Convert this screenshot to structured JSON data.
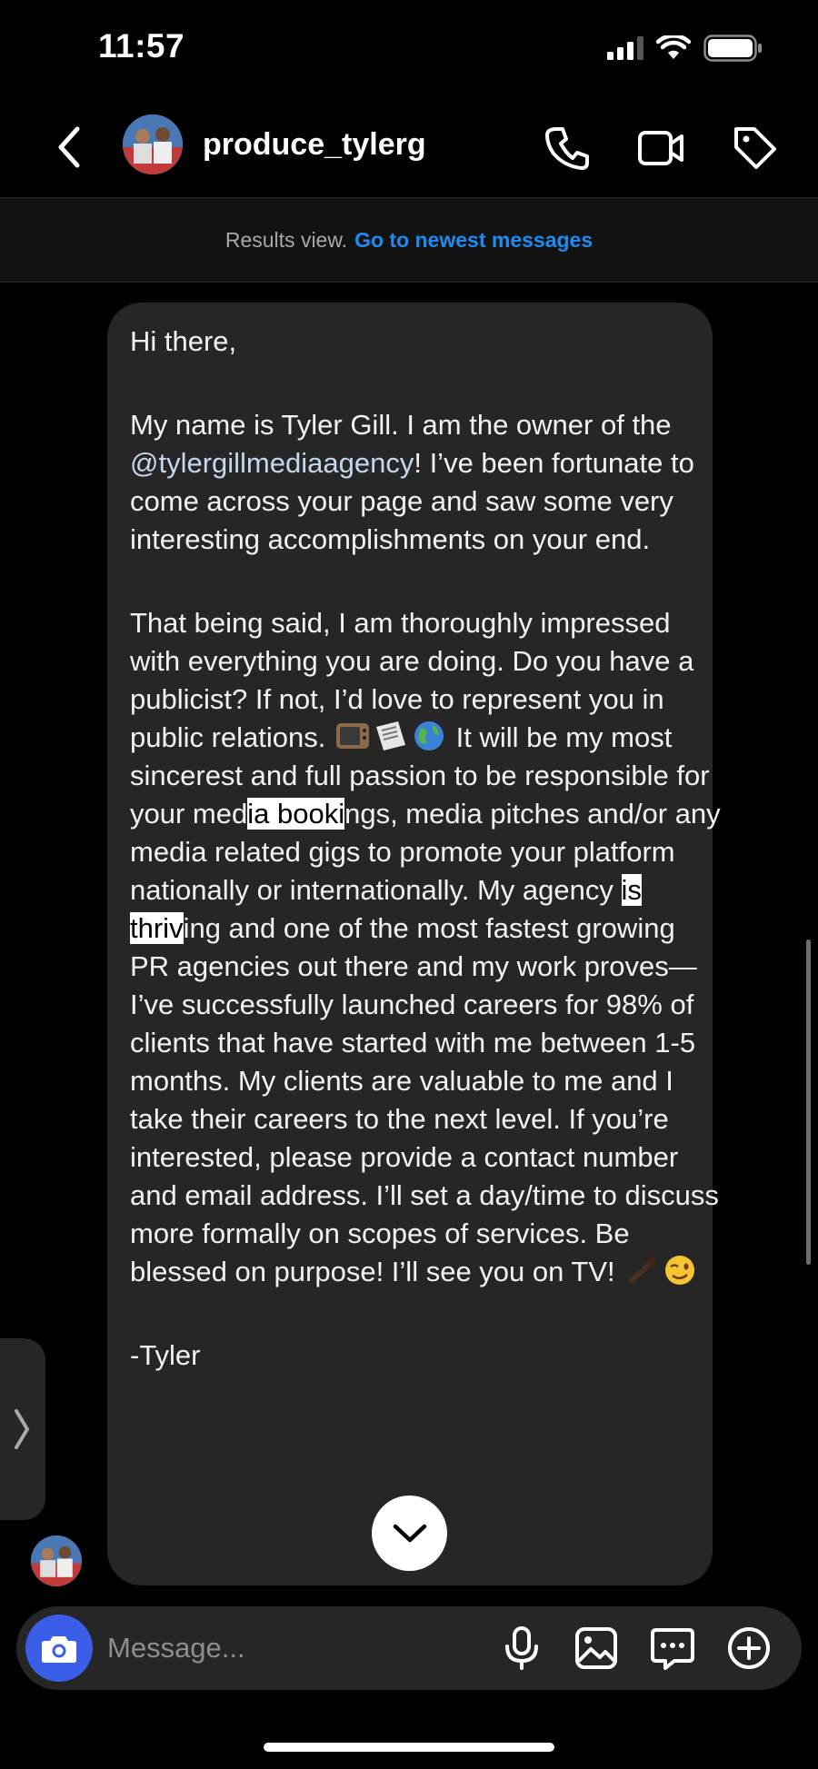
{
  "status": {
    "time": "11:57"
  },
  "header": {
    "username": "produce_tylerg"
  },
  "results_bar": {
    "label": "Results view.",
    "link": "Go to newest messages"
  },
  "message": {
    "p1": "Hi there,",
    "p2_a": "My name is Tyler Gill. I am the owner of the ",
    "p2_mention": "@tylergillmediaagency",
    "p2_b": "! I’ve been fortunate to come across your page and saw some very interesting accomplishments on your end.",
    "p3_a": "That being said, I am thoroughly impressed with everything you are doing. Do you have a publicist? If not, I’d love to represent you in public relations.",
    "p3_b": " It will be my most sincerest and full passion to be responsible for your med",
    "p3_hl1": "ia booki",
    "p3_c": "ngs, media pitches and/or any media related gigs to promote your platform nationally or internationally. My agency ",
    "p3_hl2": "is thriv",
    "p3_d": "ing and one of the most fastest growing PR agencies out there and my work proves—I’ve successfully launched careers for 98% of clients that have started with me between 1-5 months. My clients are valuable to me and I take their careers to the next level. If you’re interested, please provide a contact number and email address. I’ll set a day/time to discuss more formally on scopes of services. Be blessed on purpose! I’ll see you on TV!",
    "p4": "-Tyler",
    "emojis": [
      "tv-emoji",
      "newspaper-emoji",
      "globe-emoji",
      "writing-hand-emoji",
      "winking-face-emoji"
    ]
  },
  "composer": {
    "placeholder": "Message..."
  },
  "colors": {
    "link": "#1d8cf2",
    "camera_button": "#3a5ee8",
    "bubble": "#262626",
    "mention": "#c3d7ef"
  }
}
